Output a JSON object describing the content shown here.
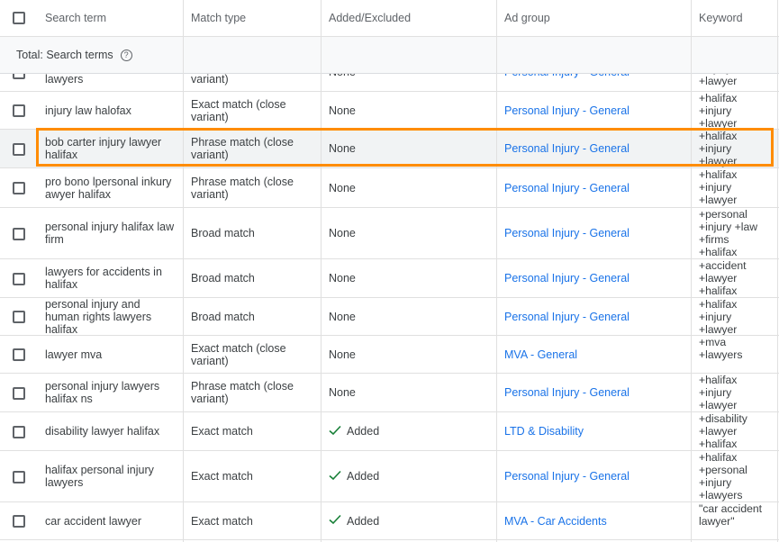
{
  "header": {
    "search_term": "Search term",
    "match_type": "Match type",
    "added_excluded": "Added/Excluded",
    "ad_group": "Ad group",
    "keyword": "Keyword"
  },
  "total": {
    "label": "Total: Search terms",
    "help_icon": "help-circle-icon"
  },
  "partial_row": {
    "term": "lawyers",
    "match": "variant)",
    "status": "None",
    "ad_group": "Personal Injury - General",
    "keyword": "+injury\n+lawyer"
  },
  "rows": [
    {
      "term": "injury law halofax",
      "match": "Exact match (close variant)",
      "status": "None",
      "added": false,
      "ad_group": "Personal Injury - General",
      "keyword": "+halifax\n+injury\n+lawyer"
    },
    {
      "term": "bob carter injury lawyer halifax",
      "match": "Phrase match (close variant)",
      "status": "None",
      "added": false,
      "ad_group": "Personal Injury - General",
      "keyword": "+halifax\n+injury\n+lawyer"
    },
    {
      "term": "pro bono lpersonal inkury awyer halifax",
      "match": "Phrase match (close variant)",
      "status": "None",
      "added": false,
      "ad_group": "Personal Injury - General",
      "keyword": "+halifax\n+injury\n+lawyer"
    },
    {
      "term": "personal injury halifax law firm",
      "match": "Broad match",
      "status": "None",
      "added": false,
      "ad_group": "Personal Injury - General",
      "keyword": "+personal\n+injury +law\n+firms\n+halifax"
    },
    {
      "term": "lawyers for accidents in halifax",
      "match": "Broad match",
      "status": "None",
      "added": false,
      "ad_group": "Personal Injury - General",
      "keyword": "+accident\n+lawyer\n+halifax"
    },
    {
      "term": "personal injury and human rights lawyers halifax",
      "match": "Broad match",
      "status": "None",
      "added": false,
      "ad_group": "Personal Injury - General",
      "keyword": "+halifax\n+injury\n+lawyer"
    },
    {
      "term": "lawyer mva",
      "match": "Exact match (close variant)",
      "status": "None",
      "added": false,
      "ad_group": "MVA - General",
      "keyword": "+mva\n+lawyers"
    },
    {
      "term": "personal injury lawyers halifax ns",
      "match": "Phrase match (close variant)",
      "status": "None",
      "added": false,
      "ad_group": "Personal Injury - General",
      "keyword": "+halifax\n+injury\n+lawyer"
    },
    {
      "term": "disability lawyer halifax",
      "match": "Exact match",
      "status": "Added",
      "added": true,
      "ad_group": "LTD & Disability",
      "keyword": "+disability\n+lawyer\n+halifax"
    },
    {
      "term": "halifax personal injury lawyers",
      "match": "Exact match",
      "status": "Added",
      "added": true,
      "ad_group": "Personal Injury - General",
      "keyword": "+halifax\n+personal\n+injury\n+lawyers"
    },
    {
      "term": "car accident lawyer",
      "match": "Exact match",
      "status": "Added",
      "added": true,
      "ad_group": "MVA - Car Accidents",
      "keyword": "\"car accident\nlawyer\""
    }
  ],
  "highlight_color": "#ff8c00",
  "link_color": "#1a73e8",
  "check_color": "#188038"
}
